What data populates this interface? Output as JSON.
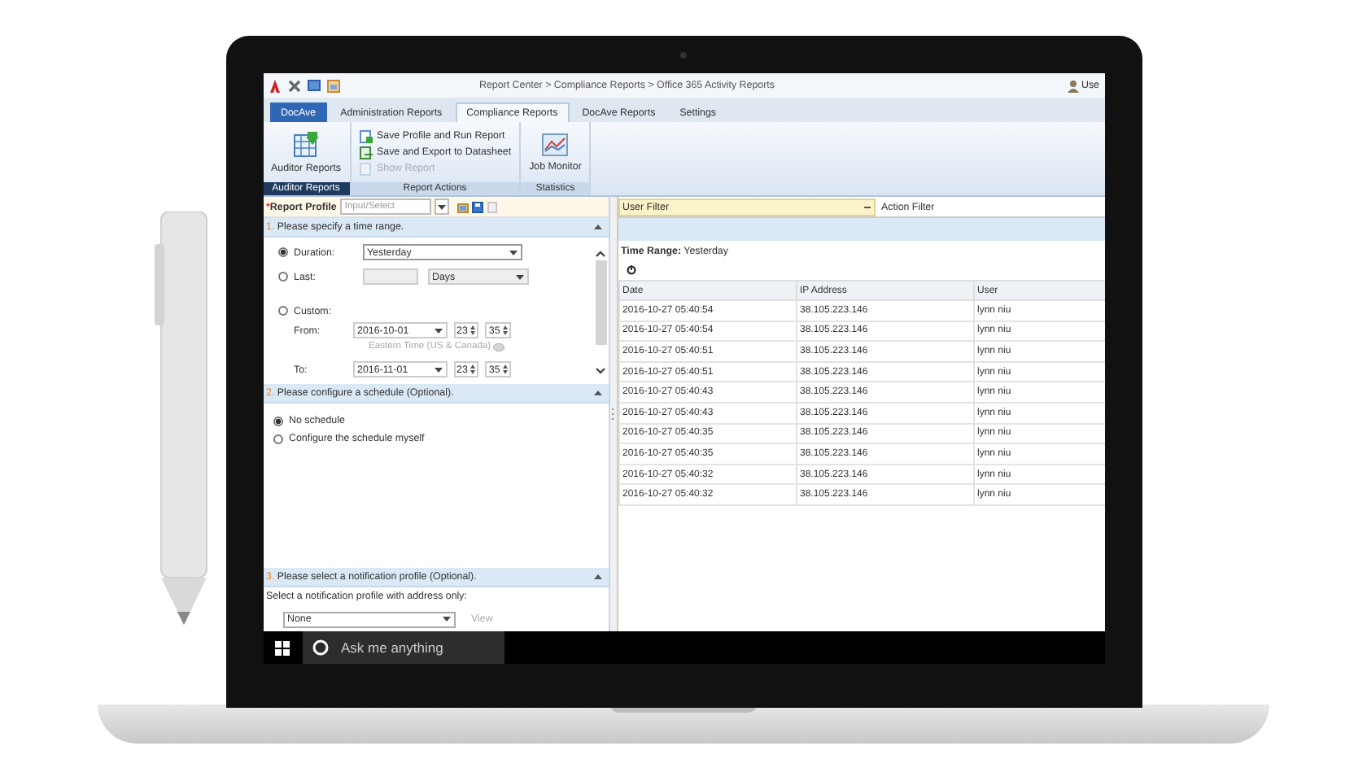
{
  "window": {
    "title": "Report Center > Compliance Reports > Office 365 Activity Reports",
    "user": "Use"
  },
  "tabs": [
    {
      "label": "DocAve",
      "selected": false,
      "kind": "home"
    },
    {
      "label": "Administration Reports",
      "selected": false,
      "kind": "tab"
    },
    {
      "label": "Compliance Reports",
      "selected": true,
      "kind": "tab"
    },
    {
      "label": "DocAve Reports",
      "selected": false,
      "kind": "tab"
    },
    {
      "label": "Settings",
      "selected": false,
      "kind": "tab"
    }
  ],
  "ribbon": {
    "groups": [
      {
        "label": "Auditor Reports",
        "selected": true,
        "buttons": [
          {
            "label": "Auditor Reports",
            "kind": "large",
            "disabled": false
          }
        ]
      },
      {
        "label": "Report Actions",
        "selected": false,
        "buttons": [
          {
            "label": "Save Profile and Run Report",
            "kind": "small",
            "disabled": false
          },
          {
            "label": "Save and Export to Datasheet",
            "kind": "small",
            "disabled": false
          },
          {
            "label": "Show Report",
            "kind": "small",
            "disabled": true
          }
        ]
      },
      {
        "label": "Statistics",
        "selected": false,
        "buttons": [
          {
            "label": "Job Monitor",
            "kind": "large",
            "disabled": false
          }
        ]
      }
    ]
  },
  "report_profile": {
    "mark": "*",
    "label": "Report Profile",
    "placeholder": "Input/Select"
  },
  "sections": [
    {
      "number": "1.",
      "title": "Please specify a time range."
    },
    {
      "number": "2.",
      "title": "Please configure a schedule (Optional)."
    },
    {
      "number": "3.",
      "title": "Please select a notification profile (Optional)."
    }
  ],
  "time_range": {
    "options": [
      {
        "kind": "duration",
        "label": "Duration:",
        "selected": true,
        "value": "Yesterday"
      },
      {
        "kind": "last",
        "label": "Last:",
        "selected": false,
        "unit": "Days"
      },
      {
        "kind": "custom",
        "label": "Custom:",
        "selected": false
      }
    ],
    "from": {
      "label": "From:",
      "date": "2016-10-01",
      "hour": "23",
      "minute": "35"
    },
    "timezone": "Eastern Time (US & Canada)",
    "to": {
      "label": "To:",
      "date": "2016-11-01",
      "hour": "23",
      "minute": "35"
    }
  },
  "schedule": {
    "options": [
      {
        "label": "No schedule",
        "selected": true
      },
      {
        "label": "Configure the schedule myself",
        "selected": false
      }
    ]
  },
  "notification": {
    "prompt": "Select a notification profile with address only:",
    "value": "None",
    "view": "View"
  },
  "filters": {
    "user_filter": "User Filter",
    "action_filter": "Action Filter"
  },
  "summary": {
    "label": "Time Range:",
    "value": "Yesterday"
  },
  "table": {
    "columns": [
      "Date",
      "IP Address",
      "User"
    ],
    "rows": [
      [
        "2016-10-27 05:40:54",
        "38.105.223.146",
        "lynn niu"
      ],
      [
        "2016-10-27 05:40:54",
        "38.105.223.146",
        "lynn niu"
      ],
      [
        "2016-10-27 05:40:51",
        "38.105.223.146",
        "lynn niu"
      ],
      [
        "2016-10-27 05:40:51",
        "38.105.223.146",
        "lynn niu"
      ],
      [
        "2016-10-27 05:40:43",
        "38.105.223.146",
        "lynn niu"
      ],
      [
        "2016-10-27 05:40:43",
        "38.105.223.146",
        "lynn niu"
      ],
      [
        "2016-10-27 05:40:35",
        "38.105.223.146",
        "lynn niu"
      ],
      [
        "2016-10-27 05:40:35",
        "38.105.223.146",
        "lynn niu"
      ],
      [
        "2016-10-27 05:40:32",
        "38.105.223.146",
        "lynn niu"
      ],
      [
        "2016-10-27 05:40:32",
        "38.105.223.146",
        "lynn niu"
      ]
    ]
  },
  "taskbar": {
    "search_placeholder": "Ask me anything"
  }
}
